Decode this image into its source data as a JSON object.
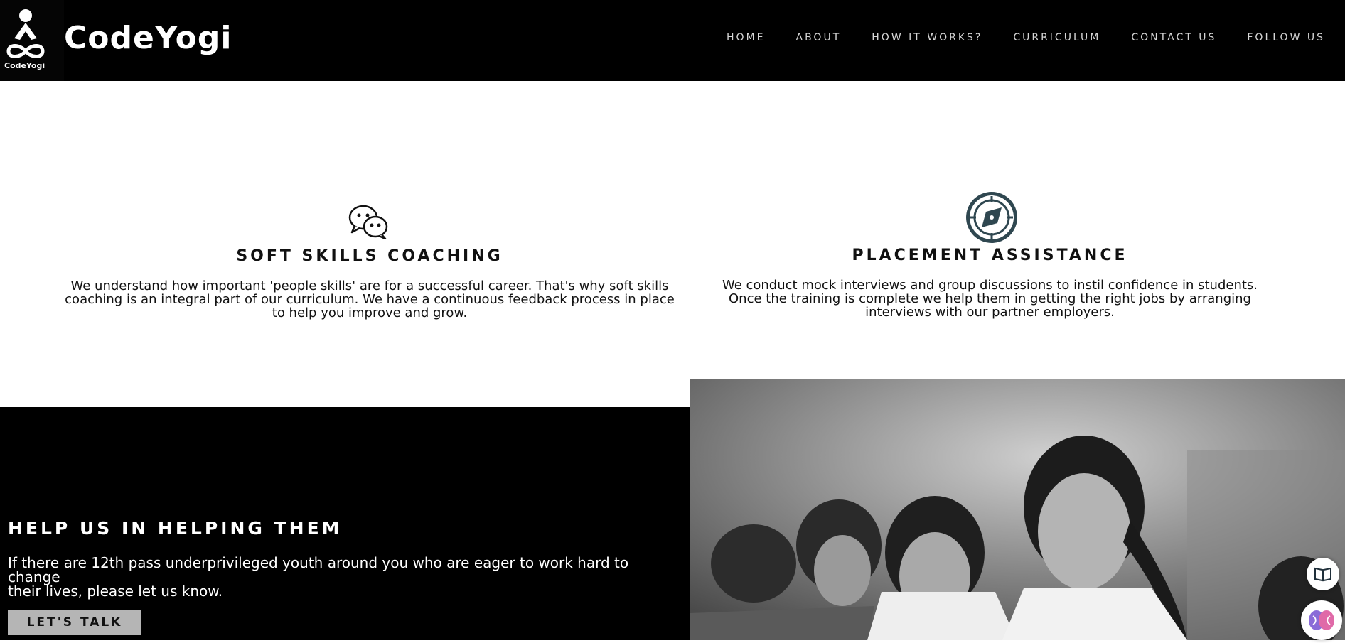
{
  "brand": {
    "name": "CodeYogi",
    "logo_caption": "CodeYogi",
    "logo_icon": "meditating-yogi-infinity-icon"
  },
  "nav": {
    "items": [
      {
        "label": "HOME"
      },
      {
        "label": "ABOUT"
      },
      {
        "label": "HOW IT WORKS?"
      },
      {
        "label": "CURRICULUM"
      },
      {
        "label": "CONTACT US"
      },
      {
        "label": "FOLLOW US"
      }
    ]
  },
  "features": [
    {
      "icon": "chat-bubbles-icon",
      "title": "SOFT SKILLS COACHING",
      "desc": [
        "We understand how important 'people skills' are for a successful career. That's why soft skills",
        "coaching is an integral part of our curriculum. We have a continuous feedback process in place",
        "to help you improve and grow."
      ]
    },
    {
      "icon": "compass-icon",
      "title": "PLACEMENT ASSISTANCE",
      "desc": [
        "We conduct mock interviews and group discussions to instil confidence in students.",
        "Once the training is complete we help them in getting the right jobs by arranging",
        "interviews with our partner employers."
      ]
    }
  ],
  "help": {
    "title": "HELP US IN HELPING THEM",
    "desc": [
      "If there are 12th pass underprivileged youth around you who are eager to work hard to change",
      "their lives, please let us know."
    ],
    "button": "LET'S TALK"
  },
  "widgets": {
    "reader": "book-reader-icon",
    "assistant": "brain-icon"
  },
  "colors": {
    "header_bg": "#000000",
    "icon_teal": "#2f4750",
    "button_bg": "#b5b5b5"
  }
}
